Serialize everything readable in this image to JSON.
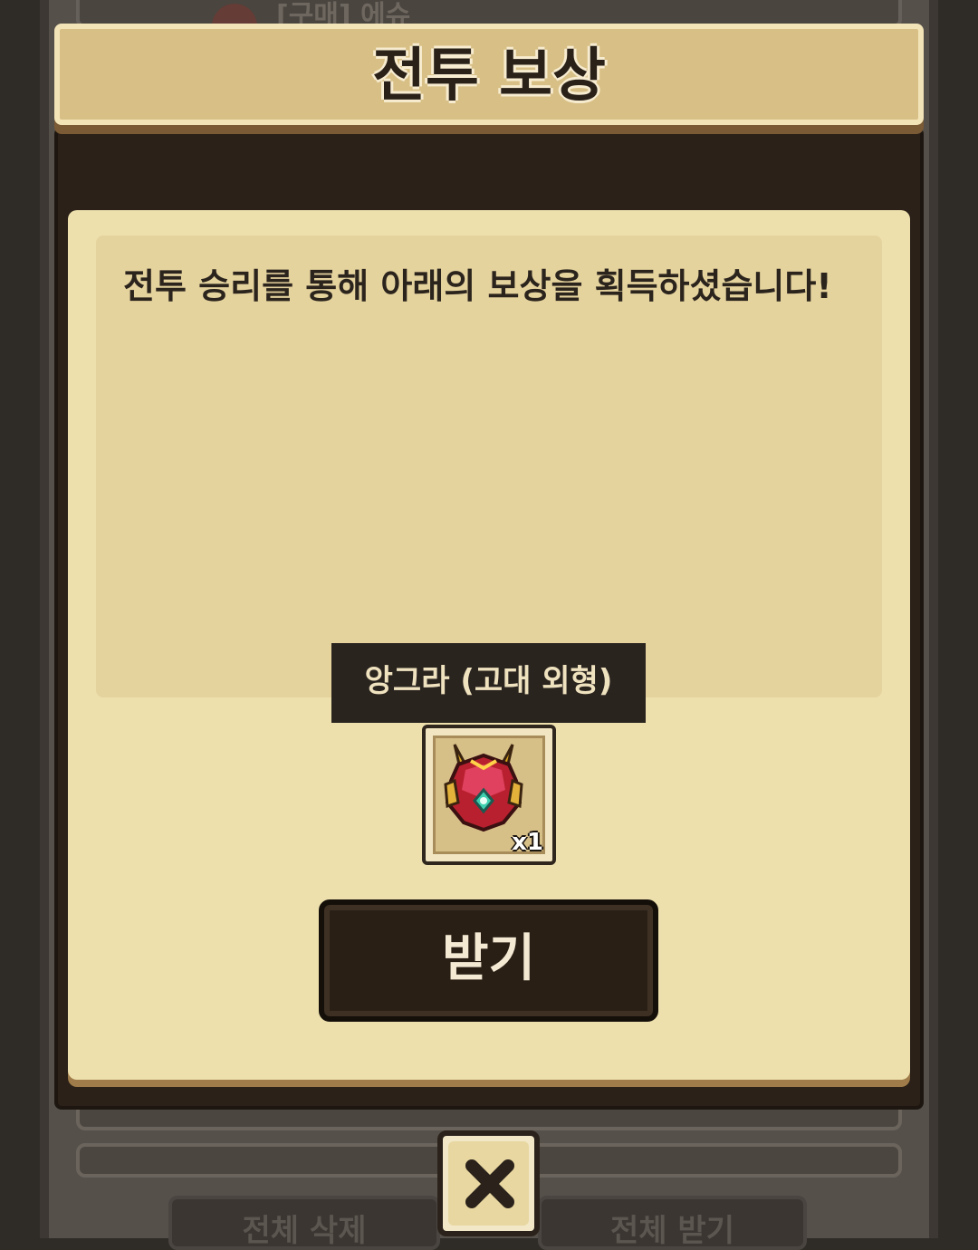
{
  "background": {
    "top_notice_text": "[구매] 에슈",
    "bottom_button_left": "전체 삭제",
    "bottom_button_right": "전체 받기"
  },
  "dialog": {
    "title": "전투 보상",
    "message": "전투 승리를 통해 아래의 보상을 획득하셨습니다!",
    "reward": {
      "name": "앙그라 (고대 외형)",
      "icon": "ornate-armor-icon",
      "count_label": "x1"
    },
    "receive_button_label": "받기",
    "close_icon": "close-icon"
  },
  "colors": {
    "banner": "#d8bf85",
    "paper": "#ede0ad",
    "dark_wood": "#2b2118",
    "button_dark": "#2a1f15"
  }
}
